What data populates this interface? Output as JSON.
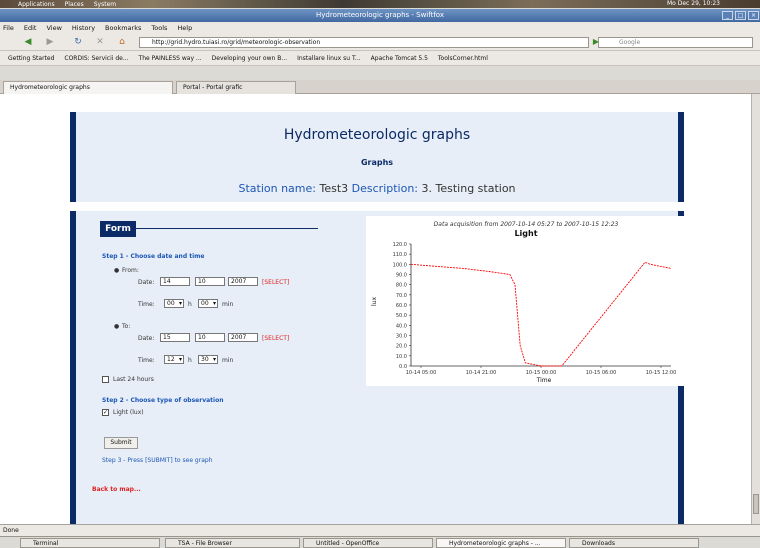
{
  "panel": {
    "items": [
      "Applications",
      "Places",
      "System"
    ],
    "clock": "Mo Dec 29, 10:23"
  },
  "window": {
    "title": "Hydrometeorologic graphs - Swiftfox"
  },
  "menu": [
    "File",
    "Edit",
    "View",
    "History",
    "Bookmarks",
    "Tools",
    "Help"
  ],
  "nav": {
    "url": "http://grid.hydro.tuiasi.ro/grid/meteorologic-observation",
    "search_placeholder": "Google"
  },
  "bookmarks": [
    "Getting Started",
    "CORDIS: Servicii de...",
    "The PAINLESS way ...",
    "Developing your own B...",
    "Installare linux su T...",
    "Apache Tomcat 5.5",
    "ToolsCorner.html"
  ],
  "tabs": [
    {
      "label": "Hydrometeorologic graphs",
      "active": true
    },
    {
      "label": "Portal - Portal grafic",
      "active": false
    }
  ],
  "header": {
    "title": "Hydrometeorologic graphs",
    "subtitle": "Graphs",
    "station_key": "Station name:",
    "station_value": "Test3",
    "desc_key": "Description:",
    "desc_value": "3. Testing station"
  },
  "form": {
    "legend": "Form",
    "step1": "Step 1 - Choose date and time",
    "from_label": "From:",
    "date_label": "Date:",
    "time_label": "Time:",
    "from_day": "14",
    "from_month": "10",
    "from_year": "2007",
    "from_hour": "00",
    "from_min": "00",
    "select_link": "[SELECT]",
    "h_label": "h",
    "min_label": "min",
    "to_label": "To:",
    "to_day": "15",
    "to_month": "10",
    "to_year": "2007",
    "to_hour": "12",
    "to_min": "30",
    "last24": "Last 24 hours",
    "step2": "Step 2 - Choose type of observation",
    "obs_light": "Light (lux)",
    "submit": "Submit",
    "step3": "Step 3 - Press [SUBMIT] to see graph",
    "back": "Back to map..."
  },
  "chart_data": {
    "type": "line",
    "title": "Light",
    "subtitle": "Data acquisition from 2007-10-14 05:27 to 2007-10-15 12:23",
    "xlabel": "Time",
    "ylabel": "lux",
    "x_ticks": [
      "10-14 05:00",
      "10-14 21:00",
      "10-15 00:00",
      "10-15 06:00",
      "10-15 12:00"
    ],
    "y_ticks": [
      "0.0",
      "10.0",
      "20.0",
      "30.0",
      "40.0",
      "50.0",
      "60.0",
      "70.0",
      "80.0",
      "90.0",
      "100.0",
      "110.0",
      "120.0"
    ],
    "ylim": [
      0,
      120
    ],
    "color": "#ff0000",
    "points": [
      [
        0.0,
        100
      ],
      [
        0.1,
        98
      ],
      [
        0.2,
        96
      ],
      [
        0.3,
        93
      ],
      [
        0.38,
        90
      ],
      [
        0.4,
        80
      ],
      [
        0.42,
        20
      ],
      [
        0.44,
        3
      ],
      [
        0.5,
        0
      ],
      [
        0.58,
        0
      ],
      [
        0.9,
        102
      ],
      [
        0.92,
        100
      ],
      [
        0.96,
        98
      ],
      [
        1.0,
        96
      ]
    ]
  },
  "status": {
    "text": "Done"
  },
  "taskbar": [
    {
      "label": "Terminal",
      "active": false
    },
    {
      "label": "TSA - File Browser",
      "active": false
    },
    {
      "label": "Untitled - OpenOffice",
      "active": false
    },
    {
      "label": "Hydrometeorologic graphs - ...",
      "active": true
    },
    {
      "label": "Downloads",
      "active": false
    }
  ]
}
